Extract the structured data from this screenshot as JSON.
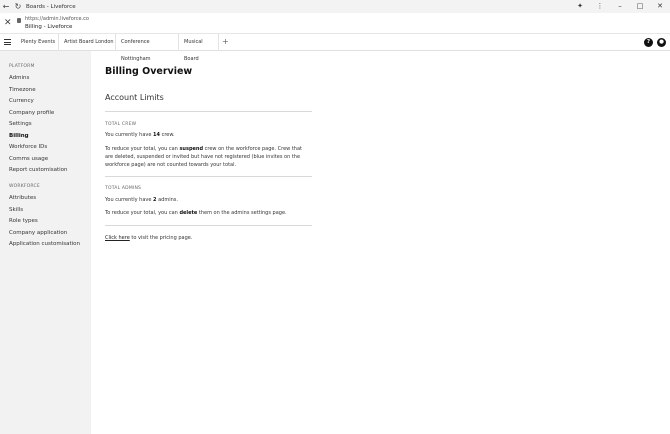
{
  "window": {
    "title": "Boards - Liveforce",
    "icons": {
      "back": "back-arrow-icon",
      "reload": "reload-icon",
      "extensions": "puzzle-icon",
      "menu": "kebab-icon"
    }
  },
  "address": {
    "url": "https://admin.liveforce.co",
    "page_title": "Billing - Liveforce"
  },
  "tabs": [
    {
      "label": "Plenty Events"
    },
    {
      "label": "Artist Board London"
    },
    {
      "label": "Conference Nottingham"
    },
    {
      "label": "Musical Board"
    }
  ],
  "tab_add": "+",
  "header_buttons": {
    "help": "?",
    "notifications": "bell-icon"
  },
  "sidebar": {
    "platform_heading": "PLATFORM",
    "platform_items": [
      {
        "label": "Admins"
      },
      {
        "label": "Timezone"
      },
      {
        "label": "Currency"
      },
      {
        "label": "Company profile"
      },
      {
        "label": "Settings"
      },
      {
        "label": "Billing",
        "active": true
      },
      {
        "label": "Workforce IDs"
      },
      {
        "label": "Comms usage"
      },
      {
        "label": "Report customisation"
      }
    ],
    "workforce_heading": "WORKFORCE",
    "workforce_items": [
      {
        "label": "Attributes"
      },
      {
        "label": "Skills"
      },
      {
        "label": "Role types"
      },
      {
        "label": "Company application"
      },
      {
        "label": "Application customisation"
      }
    ]
  },
  "main": {
    "title": "Billing Overview",
    "subtitle": "Account Limits",
    "crew": {
      "heading": "TOTAL CREW",
      "count_prefix": "You currently have ",
      "count": "14",
      "count_suffix": " crew.",
      "reduce_prefix": "To reduce your total, you can ",
      "reduce_action": "suspend",
      "reduce_suffix": " crew on the workforce page. Crew that are deleted, suspended or invited but have not registered (blue invites on the workforce page) are not counted towards your total."
    },
    "admins": {
      "heading": "TOTAL ADMINS",
      "count_prefix": "You currently have ",
      "count": "2",
      "count_suffix": " admins.",
      "reduce_prefix": "To reduce your total, you can ",
      "reduce_action": "delete",
      "reduce_suffix": " them on the admins settings page."
    },
    "pricing": {
      "link": "Click here",
      "suffix": " to visit the pricing page."
    }
  }
}
